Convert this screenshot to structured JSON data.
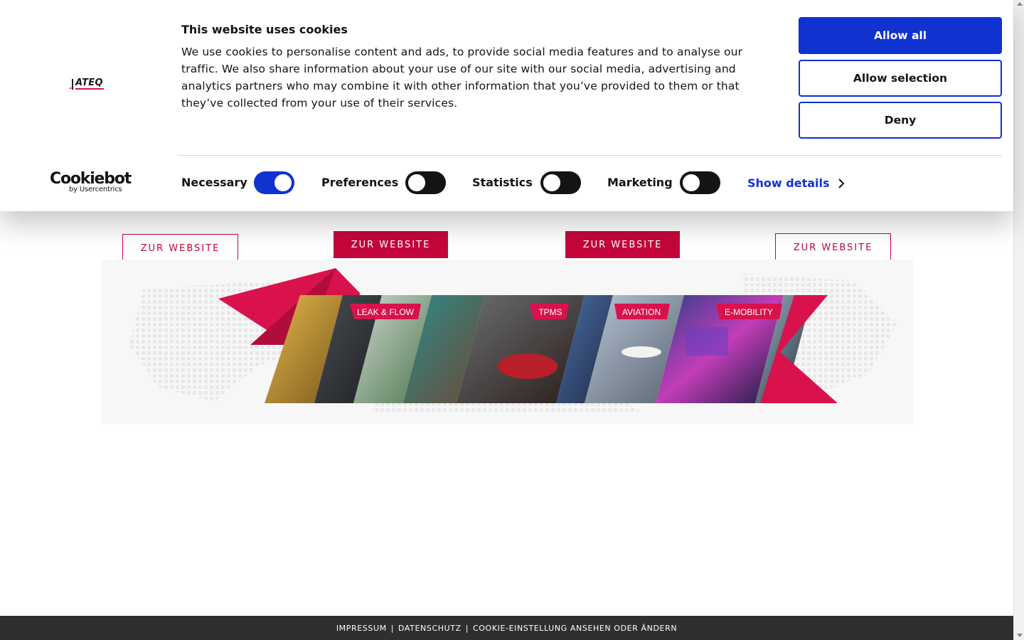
{
  "cookie_banner": {
    "title": "This website uses cookies",
    "body": "We use cookies to personalise content and ads, to provide social media features and to analyse our traffic. We also share information about your use of our site with our social media, advertising and analytics partners who may combine it with other information that you’ve provided to them or that they’ve collected from your use of their services.",
    "buttons": {
      "allow_all": "Allow all",
      "allow_selection": "Allow selection",
      "deny": "Deny"
    },
    "brand_logo_text": "ATEQ",
    "provider": {
      "name": "Cookiebot",
      "sub": "by Usercentrics"
    },
    "toggles": [
      {
        "label": "Necessary",
        "state": "on"
      },
      {
        "label": "Preferences",
        "state": "off"
      },
      {
        "label": "Statistics",
        "state": "off"
      },
      {
        "label": "Marketing",
        "state": "off"
      }
    ],
    "show_details": "Show details",
    "accent_color": "#1032cf"
  },
  "main": {
    "website_buttons": [
      {
        "label": "ZUR WEBSITE",
        "style": "outline"
      },
      {
        "label": "ZUR WEBSITE",
        "style": "filled"
      },
      {
        "label": "ZUR WEBSITE",
        "style": "filled"
      },
      {
        "label": "ZUR WEBSITE",
        "style": "outline"
      }
    ],
    "hero_banner": {
      "labels": [
        "LEAK & FLOW",
        "TPMS",
        "AVIATION",
        "E-MOBILITY"
      ],
      "accent_color": "#d9124d"
    }
  },
  "footer": {
    "links": [
      "IMPRESSUM",
      "DATENSCHUTZ",
      "COOKIE-EINSTELLUNG ANSEHEN ODER ÄNDERN"
    ],
    "separator": "|"
  }
}
